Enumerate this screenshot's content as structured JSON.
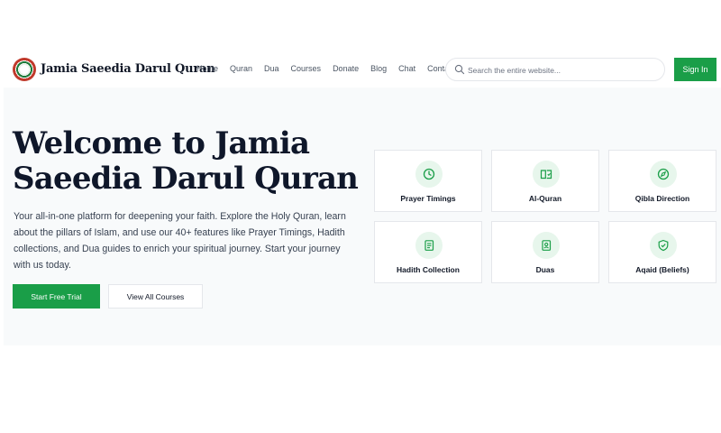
{
  "header": {
    "brand": "Jamia Saeedia Darul Quran",
    "nav": [
      "Home",
      "Quran",
      "Dua",
      "Courses",
      "Donate",
      "Blog",
      "Chat",
      "Contact"
    ],
    "search_placeholder": "Search the entire website...",
    "signin_label": "Sign In"
  },
  "hero": {
    "title": "Welcome to Jamia Saeedia Darul Quran",
    "description": "Your all-in-one platform for deepening your faith. Explore the Holy Quran, learn about the pillars of Islam, and use our 40+ features like Prayer Timings, Hadith collections, and Dua guides to enrich your spiritual journey. Start your journey with us today.",
    "primary_button": "Start Free Trial",
    "secondary_button": "View All Courses"
  },
  "features": [
    {
      "label": "Prayer Timings",
      "icon": "clock-icon"
    },
    {
      "label": "Al-Quran",
      "icon": "book-open-icon"
    },
    {
      "label": "Qibla Direction",
      "icon": "compass-icon"
    },
    {
      "label": "Hadith Collection",
      "icon": "book-icon"
    },
    {
      "label": "Duas",
      "icon": "hands-book-icon"
    },
    {
      "label": "Aqaid (Beliefs)",
      "icon": "shield-check-icon"
    }
  ],
  "colors": {
    "accent": "#1a9e48",
    "icon_bg": "#e7f6ec",
    "hero_bg": "#f8fafb"
  }
}
